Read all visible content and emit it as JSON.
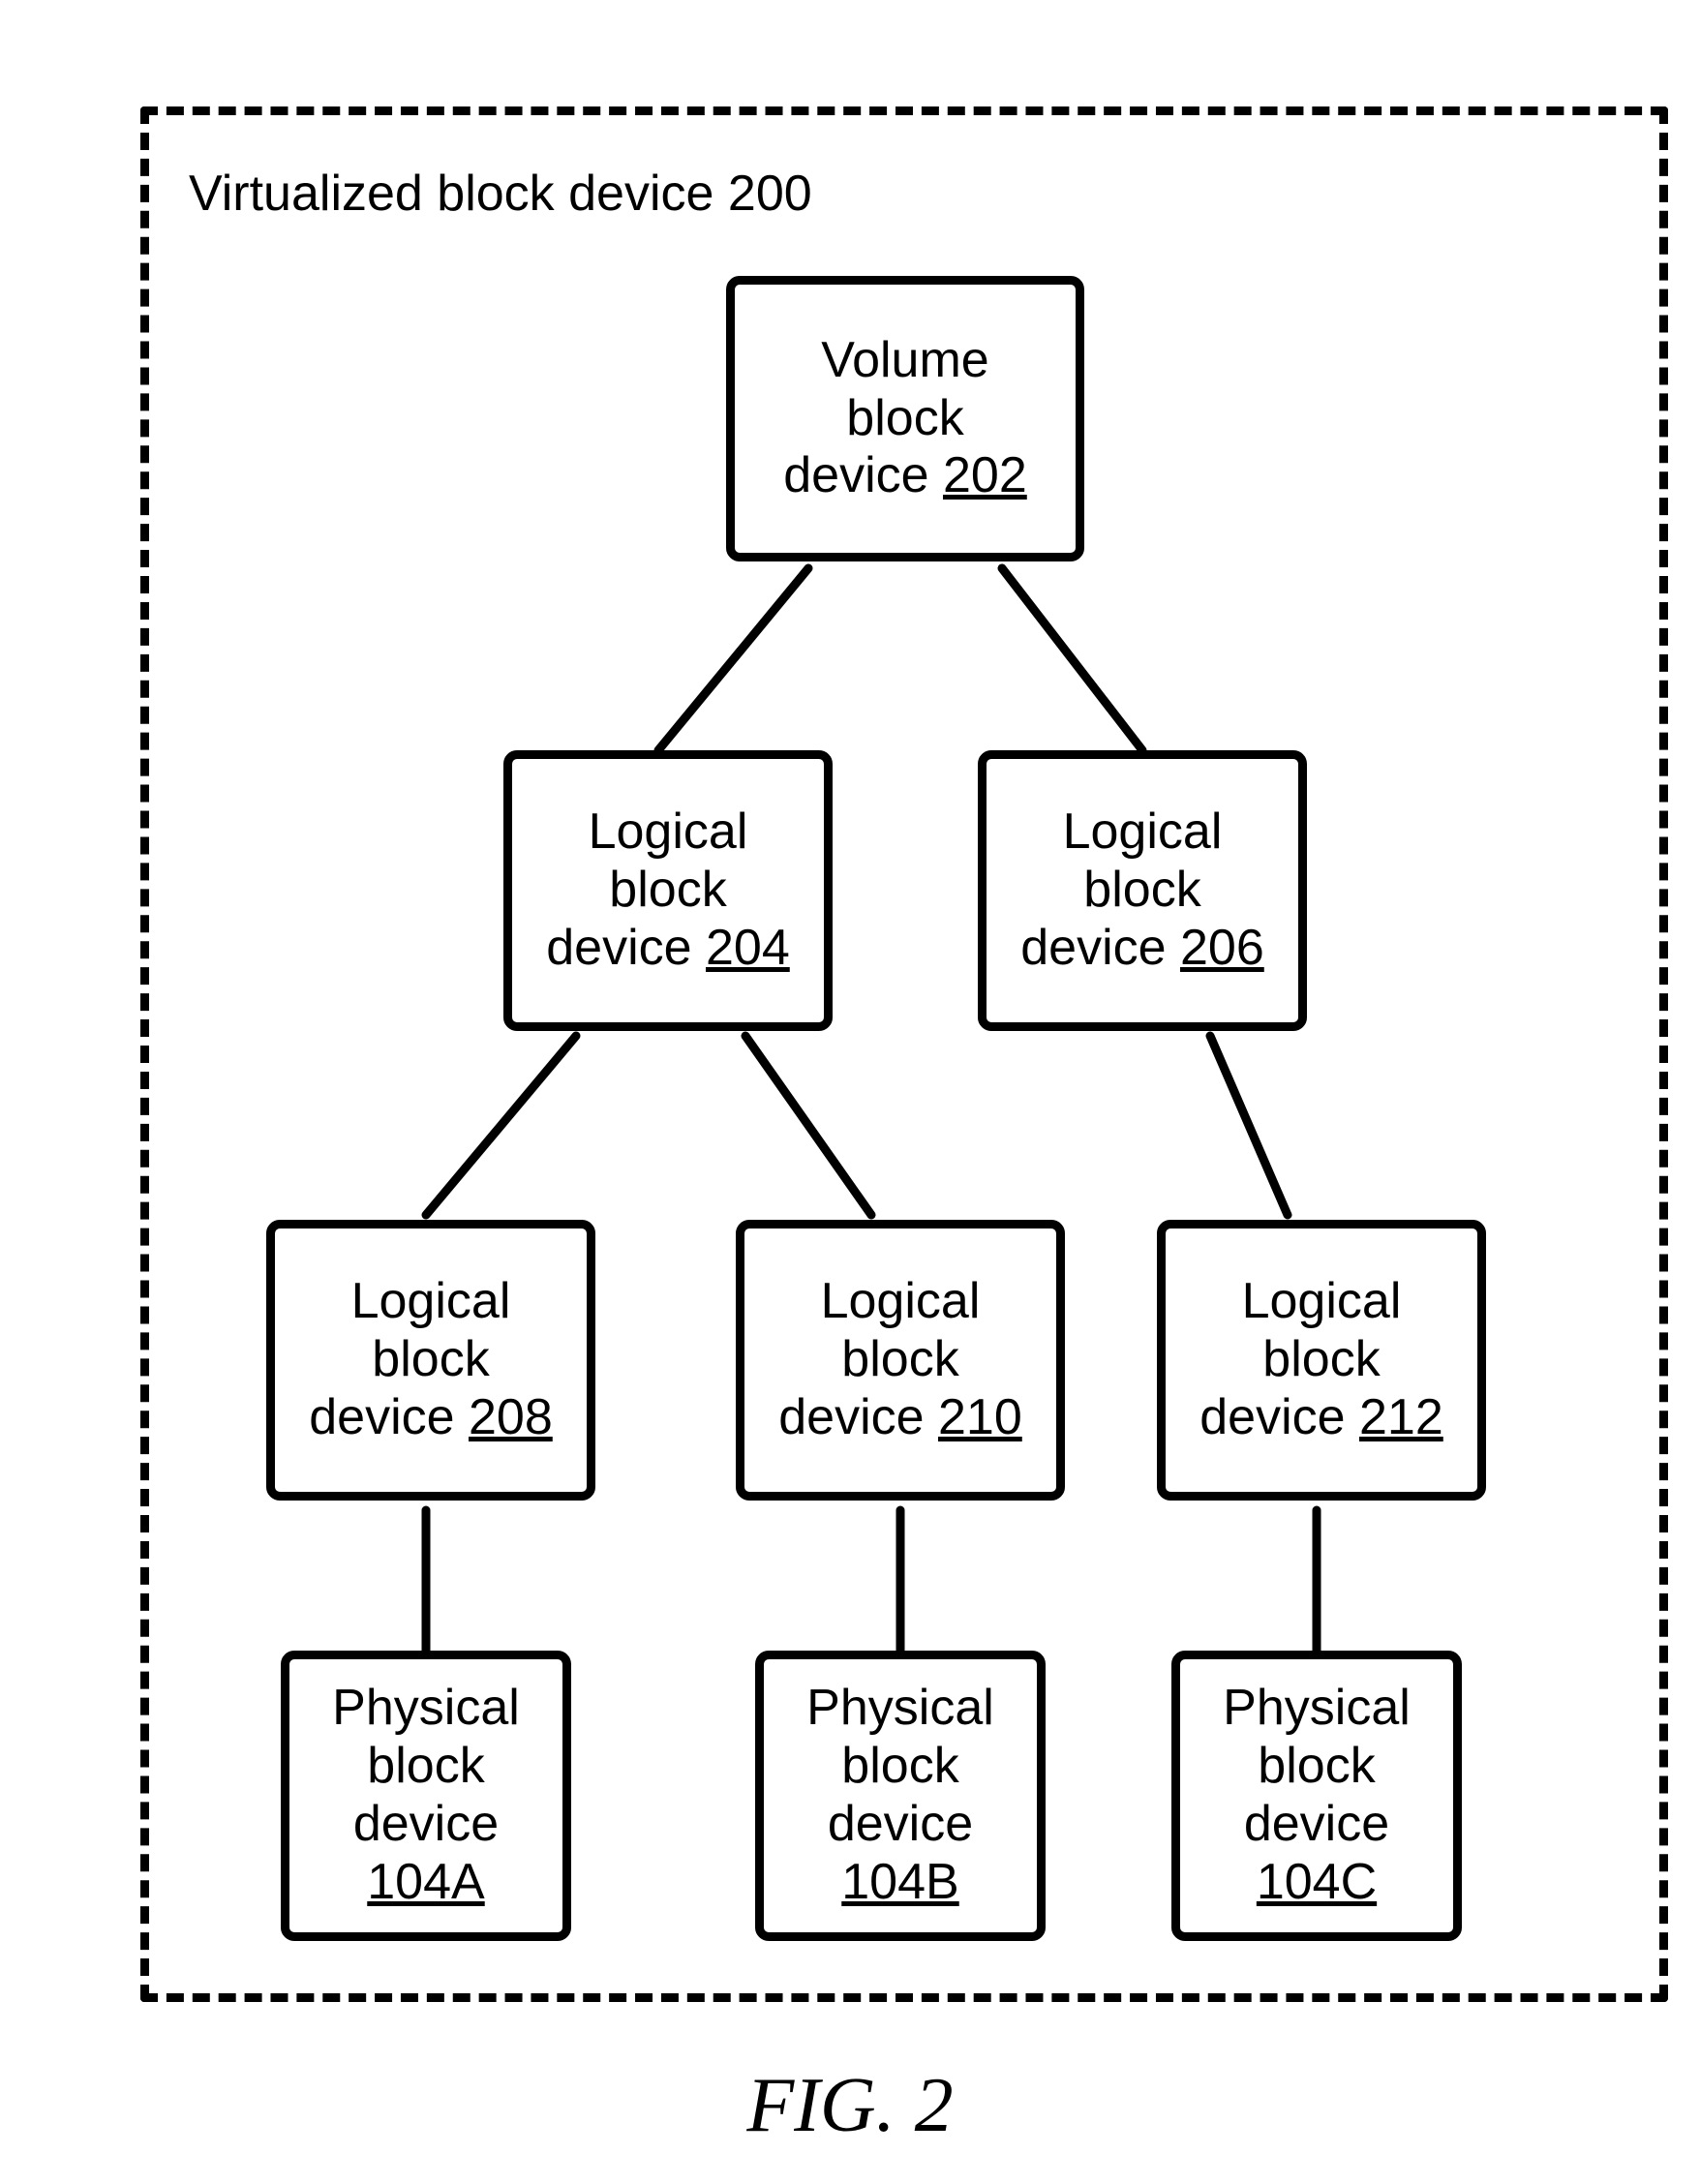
{
  "container": {
    "label_prefix": "Virtualized block device ",
    "label_ref": "200"
  },
  "nodes": {
    "volume": {
      "l1": "Volume",
      "l2": "block",
      "l3_prefix": "device ",
      "ref": "202"
    },
    "lbd204": {
      "l1": "Logical",
      "l2": "block",
      "l3_prefix": "device ",
      "ref": "204"
    },
    "lbd206": {
      "l1": "Logical",
      "l2": "block",
      "l3_prefix": "device ",
      "ref": "206"
    },
    "lbd208": {
      "l1": "Logical",
      "l2": "block",
      "l3_prefix": "device ",
      "ref": "208"
    },
    "lbd210": {
      "l1": "Logical",
      "l2": "block",
      "l3_prefix": "device ",
      "ref": "210"
    },
    "lbd212": {
      "l1": "Logical",
      "l2": "block",
      "l3_prefix": "device ",
      "ref": "212"
    },
    "pbd104a": {
      "l1": "Physical",
      "l2": "block",
      "l3": "device",
      "ref": "104A"
    },
    "pbd104b": {
      "l1": "Physical",
      "l2": "block",
      "l3": "device",
      "ref": "104B"
    },
    "pbd104c": {
      "l1": "Physical",
      "l2": "block",
      "l3": "device",
      "ref": "104C"
    }
  },
  "figure_caption": "FIG. 2"
}
